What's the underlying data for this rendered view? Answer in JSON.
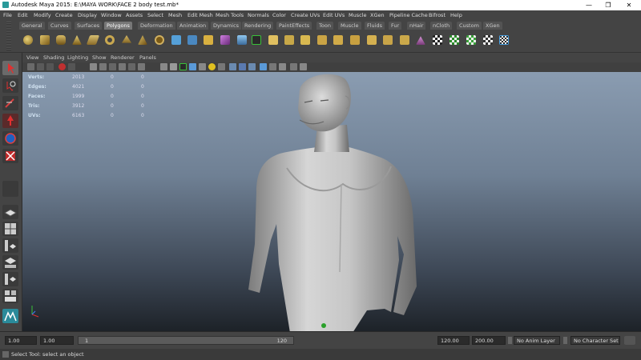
{
  "window": {
    "title": "Autodesk Maya 2015: E:\\MAYA WORK\\FACE 2 body test.mb*"
  },
  "menu": [
    "File",
    "Edit",
    "Modify",
    "Create",
    "Display",
    "Window",
    "Assets",
    "Select",
    "Mesh",
    "Edit Mesh",
    "Mesh Tools",
    "Normals",
    "Color",
    "Create UVs",
    "Edit UVs",
    "Muscle",
    "XGen",
    "Pipeline Cache",
    "Bifrost",
    "Help"
  ],
  "shelf_tabs": [
    "General",
    "Curves",
    "Surfaces",
    "Polygons",
    "Deformation",
    "Animation",
    "Dynamics",
    "Rendering",
    "PaintEffects",
    "Toon",
    "Muscle",
    "Fluids",
    "Fur",
    "nHair",
    "nCloth",
    "Custom",
    "XGen"
  ],
  "shelf_active": "Polygons",
  "viewport_menu": [
    "View",
    "Shading",
    "Lighting",
    "Show",
    "Renderer",
    "Panels"
  ],
  "hud": {
    "rows": [
      {
        "label": "Verts:",
        "v1": "2013",
        "v2": "0",
        "v3": "0"
      },
      {
        "label": "Edges:",
        "v1": "4021",
        "v2": "0",
        "v3": "0"
      },
      {
        "label": "Faces:",
        "v1": "1999",
        "v2": "0",
        "v3": "0"
      },
      {
        "label": "Tris:",
        "v1": "3912",
        "v2": "0",
        "v3": "0"
      },
      {
        "label": "UVs:",
        "v1": "6163",
        "v2": "0",
        "v3": "0"
      }
    ]
  },
  "timeline": {
    "start": "1.00",
    "current": "1.00",
    "slider_start": "1",
    "slider_end": "120",
    "range_end": "120.00",
    "anim_end": "200.00",
    "anim_layer": "No Anim Layer",
    "character_set": "No Character Set"
  },
  "help_line": "Select Tool: select an object",
  "colors": {
    "accent": "#2a9a9a",
    "bg": "#444444",
    "viewport_top": "#8a9cb1",
    "viewport_bottom": "#1d2228"
  }
}
